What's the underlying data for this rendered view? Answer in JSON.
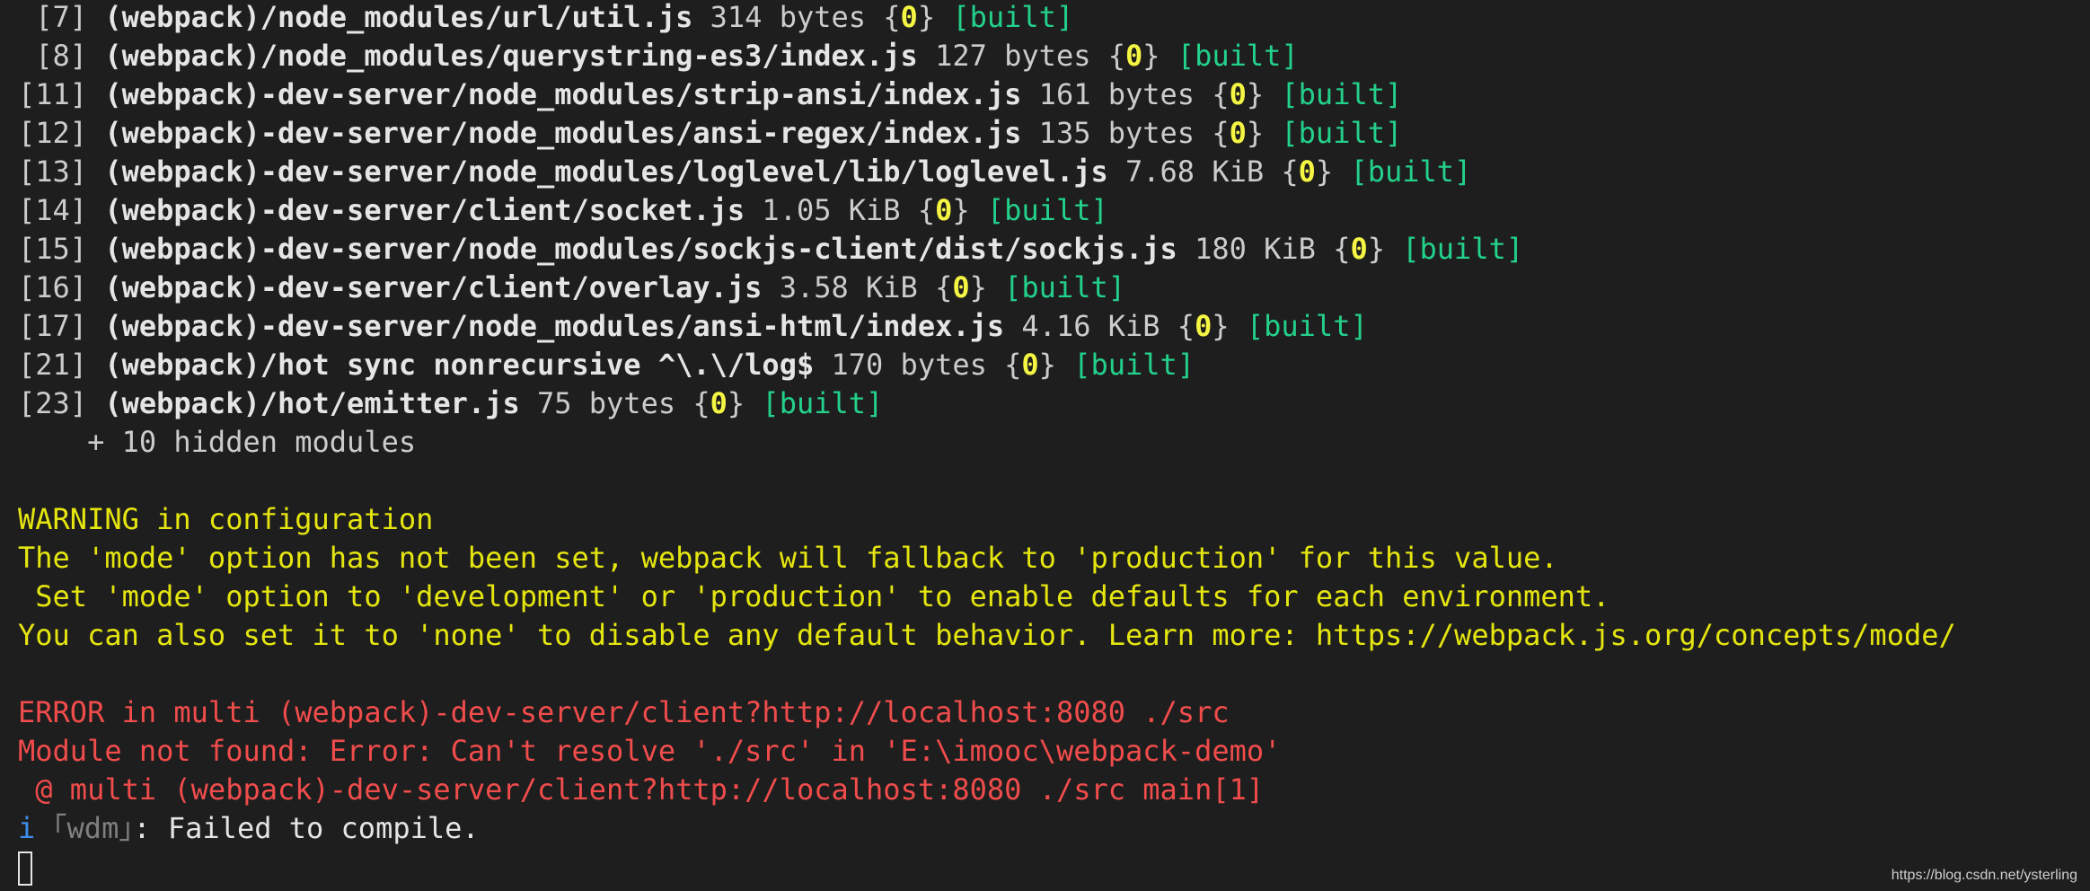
{
  "modules": [
    {
      "index": " [7]",
      "path": "(webpack)/node_modules/url/util.js",
      "size": "314 bytes",
      "chunk": "0",
      "status": "[built]"
    },
    {
      "index": " [8]",
      "path": "(webpack)/node_modules/querystring-es3/index.js",
      "size": "127 bytes",
      "chunk": "0",
      "status": "[built]"
    },
    {
      "index": "[11]",
      "path": "(webpack)-dev-server/node_modules/strip-ansi/index.js",
      "size": "161 bytes",
      "chunk": "0",
      "status": "[built]"
    },
    {
      "index": "[12]",
      "path": "(webpack)-dev-server/node_modules/ansi-regex/index.js",
      "size": "135 bytes",
      "chunk": "0",
      "status": "[built]"
    },
    {
      "index": "[13]",
      "path": "(webpack)-dev-server/node_modules/loglevel/lib/loglevel.js",
      "size": "7.68 KiB",
      "chunk": "0",
      "status": "[built]"
    },
    {
      "index": "[14]",
      "path": "(webpack)-dev-server/client/socket.js",
      "size": "1.05 KiB",
      "chunk": "0",
      "status": "[built]"
    },
    {
      "index": "[15]",
      "path": "(webpack)-dev-server/node_modules/sockjs-client/dist/sockjs.js",
      "size": "180 KiB",
      "chunk": "0",
      "status": "[built]"
    },
    {
      "index": "[16]",
      "path": "(webpack)-dev-server/client/overlay.js",
      "size": "3.58 KiB",
      "chunk": "0",
      "status": "[built]"
    },
    {
      "index": "[17]",
      "path": "(webpack)-dev-server/node_modules/ansi-html/index.js",
      "size": "4.16 KiB",
      "chunk": "0",
      "status": "[built]"
    },
    {
      "index": "[21]",
      "path": "(webpack)/hot sync nonrecursive ^\\.\\/log$",
      "size": "170 bytes",
      "chunk": "0",
      "status": "[built]"
    },
    {
      "index": "[23]",
      "path": "(webpack)/hot/emitter.js",
      "size": "75 bytes",
      "chunk": "0",
      "status": "[built]"
    }
  ],
  "hidden_modules": "    + 10 hidden modules",
  "warning": [
    "WARNING in configuration",
    "The 'mode' option has not been set, webpack will fallback to 'production' for this value.",
    " Set 'mode' option to 'development' or 'production' to enable defaults for each environment.",
    "You can also set it to 'none' to disable any default behavior. Learn more: https://webpack.js.org/concepts/mode/"
  ],
  "error": [
    "ERROR in multi (webpack)-dev-server/client?http://localhost:8080 ./src",
    "Module not found: Error: Can't resolve './src' in 'E:\\imooc\\webpack-demo'",
    " @ multi (webpack)-dev-server/client?http://localhost:8080 ./src main[1]"
  ],
  "info": {
    "icon": "i",
    "tag": "｢wdm｣",
    "message": ": Failed to compile."
  },
  "watermark": "https://blog.csdn.net/ysterling",
  "colors": {
    "background": "#1e1e1e",
    "built": "#23d18b",
    "chunk": "#f5f543",
    "warning": "#e5e510",
    "error": "#f14c4c",
    "info": "#3b8eea"
  }
}
